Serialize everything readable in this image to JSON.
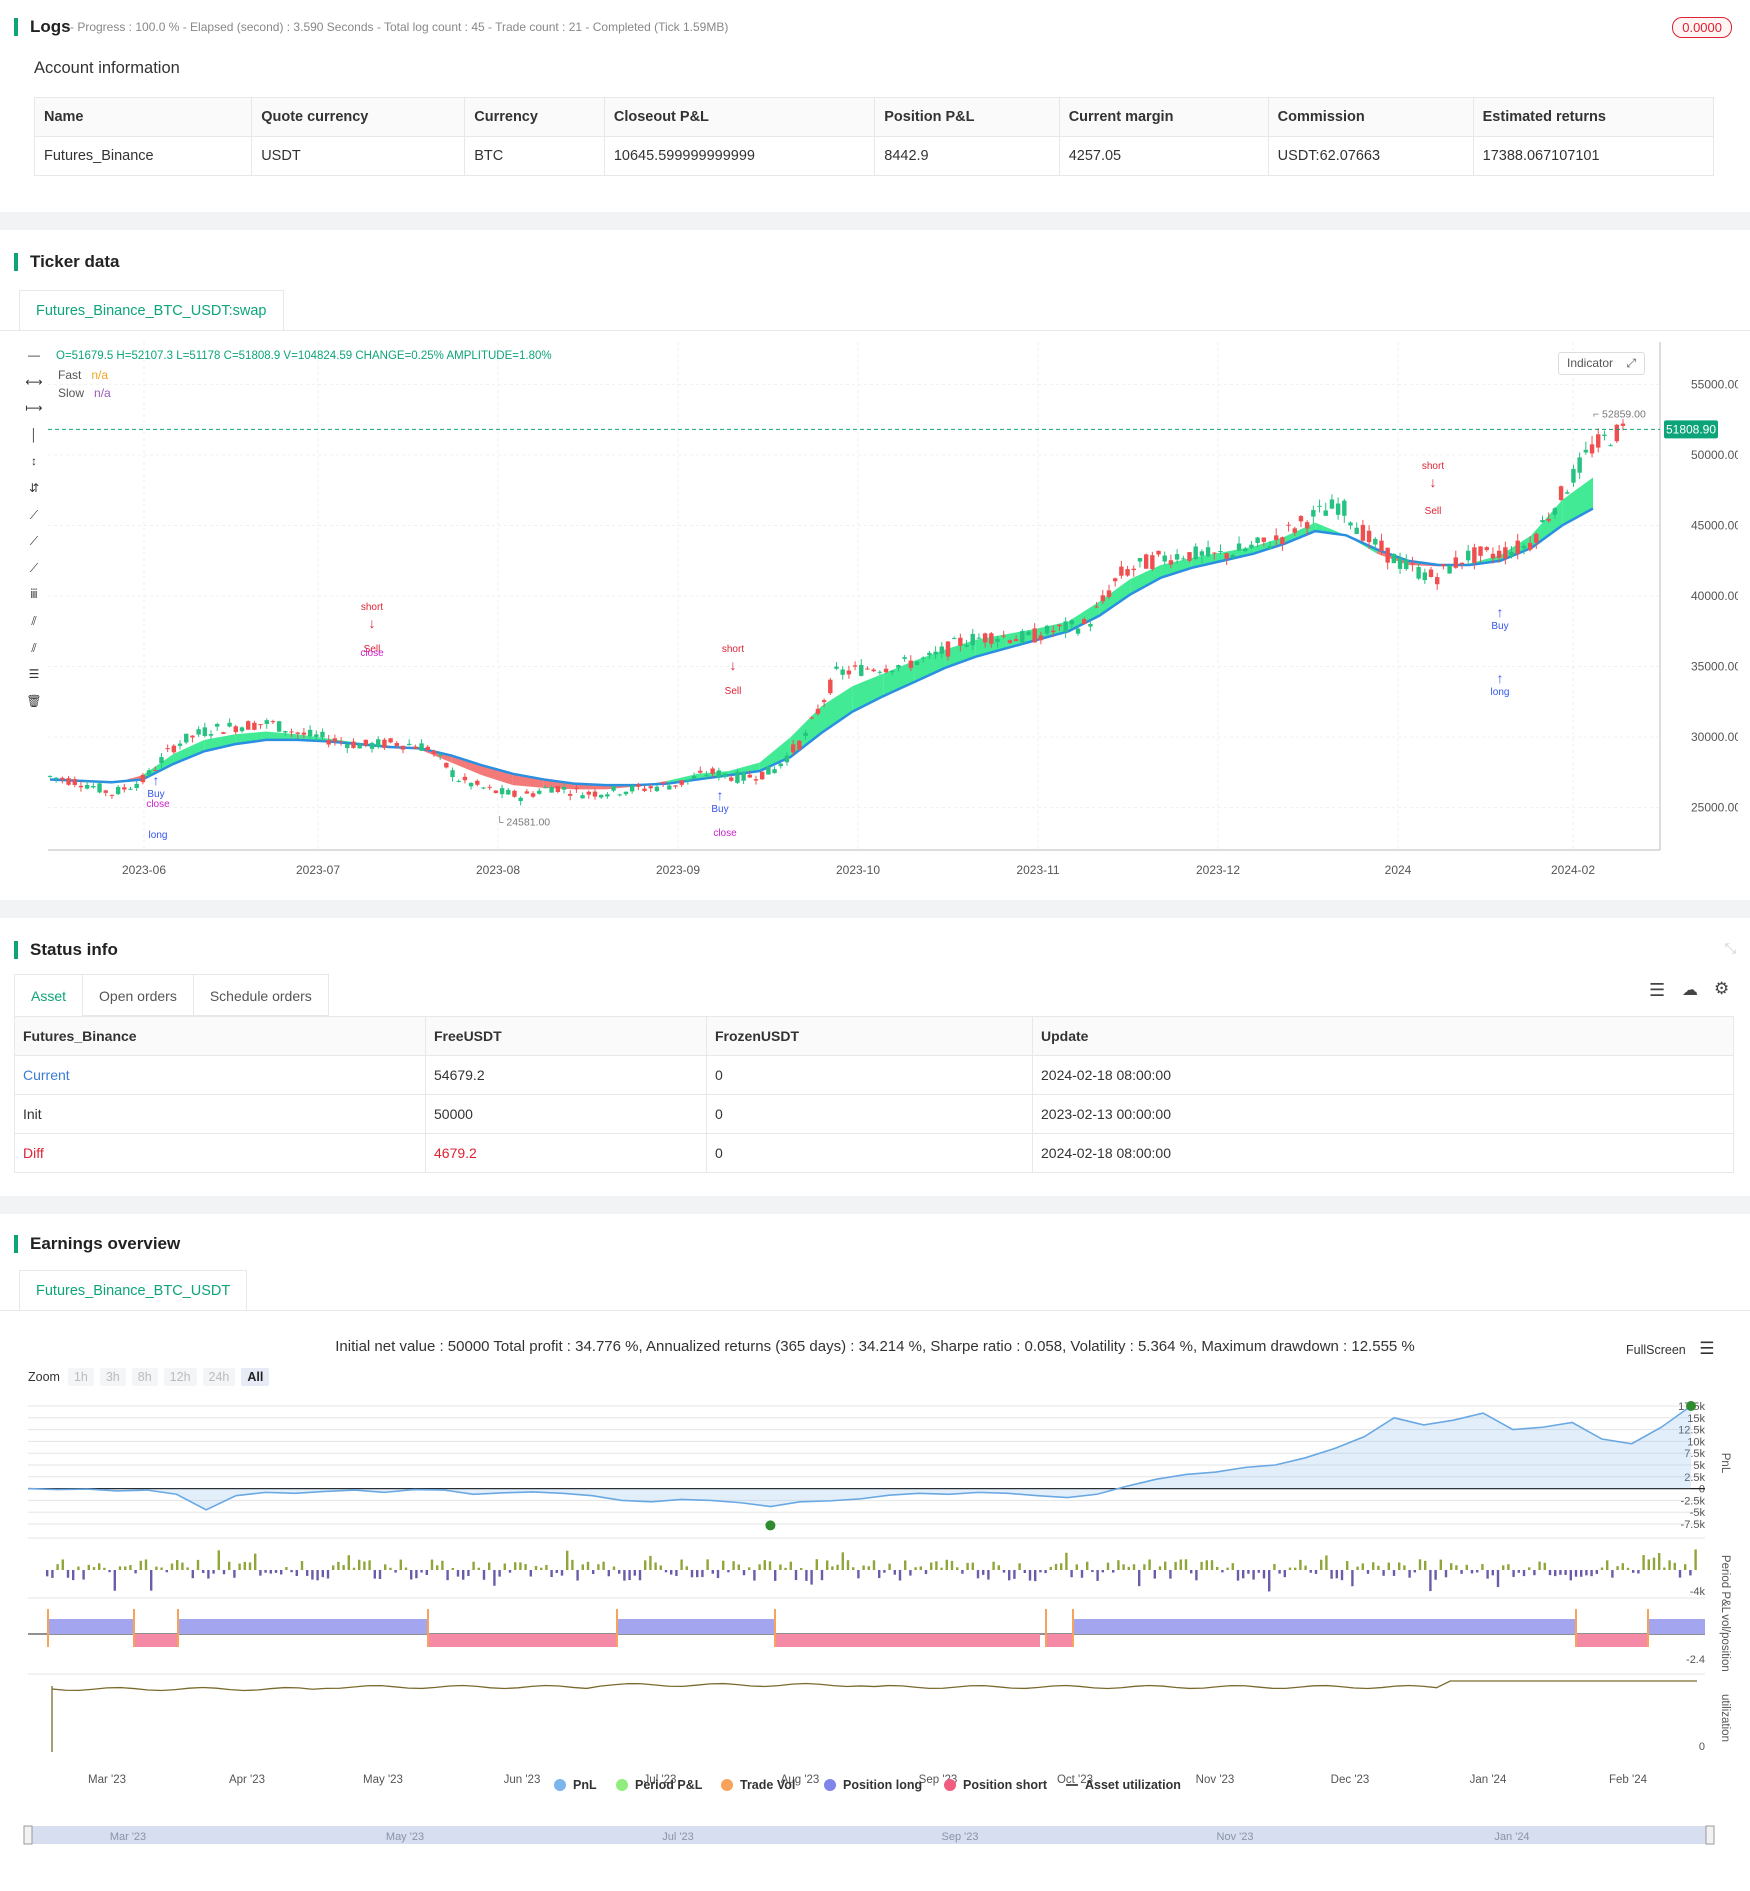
{
  "logs": {
    "title": "Logs",
    "summary": "- Progress : 100.0 % - Elapsed (second) : 3.590  Seconds - Total log count : 45 - Trade count : 21 - Completed (Tick 1.59MB)",
    "badge": "0.0000"
  },
  "account": {
    "title": "Account information",
    "columns": [
      "Name",
      "Quote currency",
      "Currency",
      "Closeout P&L",
      "Position P&L",
      "Current margin",
      "Commission",
      "Estimated returns"
    ],
    "row": [
      "Futures_Binance",
      "USDT",
      "BTC",
      "10645.599999999999",
      "8442.9",
      "4257.05",
      "USDT:62.07663",
      "17388.067107101"
    ]
  },
  "ticker": {
    "title": "Ticker data",
    "tab": "Futures_Binance_BTC_USDT:swap",
    "ohlc": "O=51679.5 H=52107.3 L=51178 C=51808.9 V=104824.59 CHANGE=0.25% AMPLITUDE=1.80%",
    "legend": [
      {
        "name": "Fast",
        "value": "n/a",
        "color": "#f5a623"
      },
      {
        "name": "Slow",
        "value": "n/a",
        "color": "#9b59b6"
      }
    ],
    "indicator_btn": "Indicator",
    "last_price": "51808.90",
    "high_label": "52859.00",
    "low_label": "24581.00",
    "y_ticks": [
      "55000.00",
      "50000.00",
      "45000.00",
      "40000.00",
      "35000.00",
      "30000.00",
      "25000.00"
    ],
    "x_ticks": [
      "2023-06",
      "2023-07",
      "2023-08",
      "2023-09",
      "2023-10",
      "2023-11",
      "2023-12",
      "2024",
      "2024-02"
    ],
    "markers": [
      {
        "text": "Buy",
        "color": "#3355ee"
      },
      {
        "text": "long",
        "color": "#3355ee"
      },
      {
        "text": "close",
        "color": "#cc22cc"
      },
      {
        "text": "short",
        "color": "#dd2233"
      },
      {
        "text": "Sell",
        "color": "#dd2233"
      },
      {
        "text": "close",
        "color": "#cc22cc"
      },
      {
        "text": "short",
        "color": "#dd2233"
      },
      {
        "text": "Sell",
        "color": "#dd2233"
      },
      {
        "text": "Buy",
        "color": "#3355ee"
      },
      {
        "text": "close",
        "color": "#cc22cc"
      },
      {
        "text": "short",
        "color": "#dd2233"
      },
      {
        "text": "Sell",
        "color": "#dd2233"
      },
      {
        "text": "long",
        "color": "#3355ee"
      },
      {
        "text": "Buy",
        "color": "#3355ee"
      }
    ],
    "chart_data": {
      "type": "candlestick",
      "x_labels": [
        "2023-06",
        "2023-07",
        "2023-08",
        "2023-09",
        "2023-10",
        "2023-11",
        "2023-12",
        "2024",
        "2024-02"
      ],
      "ylim": [
        22000,
        58000
      ],
      "close_path": [
        27200,
        26800,
        26000,
        27000,
        29500,
        30500,
        30800,
        31000,
        30200,
        29800,
        29400,
        29600,
        29300,
        27000,
        26200,
        25800,
        26500,
        26000,
        26200,
        26400,
        26700,
        27500,
        27100,
        27600,
        30000,
        34500,
        34900,
        35100,
        35600,
        36800,
        37200,
        37000,
        37600,
        38000,
        41500,
        42500,
        43000,
        42800,
        43300,
        44000,
        45500,
        46500,
        43800,
        42200,
        41300,
        42800,
        43000,
        43600,
        47000,
        50500,
        51800
      ],
      "fast_ma": [
        27000,
        26900,
        26700,
        27300,
        28800,
        29800,
        30200,
        30400,
        30200,
        29900,
        29600,
        29400,
        29100,
        28200,
        27300,
        26600,
        26400,
        26300,
        26300,
        26500,
        26900,
        27400,
        27600,
        28200,
        30000,
        32200,
        33600,
        34500,
        35400,
        36200,
        36900,
        37300,
        37700,
        38200,
        39600,
        41200,
        42200,
        42700,
        43100,
        43500,
        44200,
        45200,
        44300,
        43000,
        42200,
        42100,
        42300,
        42900,
        44300,
        46800,
        48400
      ],
      "slow_ma": [
        27000,
        26900,
        26800,
        27000,
        28100,
        29000,
        29500,
        29800,
        29800,
        29700,
        29500,
        29300,
        29200,
        28700,
        28000,
        27400,
        27000,
        26700,
        26600,
        26600,
        26700,
        27000,
        27300,
        27600,
        28600,
        30300,
        31800,
        32900,
        33900,
        34900,
        35700,
        36300,
        36900,
        37500,
        38600,
        40100,
        41300,
        42000,
        42500,
        43000,
        43700,
        44600,
        44300,
        43300,
        42500,
        42200,
        42200,
        42500,
        43400,
        45000,
        46200
      ]
    }
  },
  "status": {
    "title": "Status info",
    "tabs": [
      "Asset",
      "Open orders",
      "Schedule orders"
    ],
    "columns": [
      "Futures_Binance",
      "FreeUSDT",
      "FrozenUSDT",
      "Update"
    ],
    "rows": [
      {
        "label": "Current",
        "free": "54679.2",
        "frozen": "0",
        "update": "2024-02-18 08:00:00",
        "color": "#3a7bd5"
      },
      {
        "label": "Init",
        "free": "50000",
        "frozen": "0",
        "update": "2023-02-13 00:00:00",
        "color": "#333"
      },
      {
        "label": "Diff",
        "free": "4679.2",
        "frozen": "0",
        "update": "2024-02-18 08:00:00",
        "color": "#dd2233"
      }
    ]
  },
  "earnings": {
    "title": "Earnings overview",
    "tab": "Futures_Binance_BTC_USDT",
    "summary": "Initial net value : 50000 Total profit : 34.776 %, Annualized returns (365 days) : 34.214 %, Sharpe ratio : 0.058, Volatility : 5.364 %, Maximum drawdown : 12.555 %",
    "fullscreen": "FullScreen",
    "zoom_label": "Zoom",
    "zoom_options": [
      "1h",
      "3h",
      "8h",
      "12h",
      "24h",
      "All"
    ],
    "pnl_ticks": [
      "17.5k",
      "15k",
      "12.5k",
      "10k",
      "7.5k",
      "5k",
      "2.5k",
      "0",
      "-2.5k",
      "-5k",
      "-7.5k"
    ],
    "period_tick": "-4k",
    "pos_tick": "-2.4",
    "util_tick": "0",
    "axis_names": [
      "PnL",
      "Period P&L",
      "vol/position",
      "utilization"
    ],
    "x_ticks": [
      "Mar '23",
      "Apr '23",
      "May '23",
      "Jun '23",
      "Jul '23",
      "Aug '23",
      "Sep '23",
      "Oct '23",
      "Nov '23",
      "Dec '23",
      "Jan '24",
      "Feb '24"
    ],
    "nav_ticks": [
      "Mar '23",
      "May '23",
      "Jul '23",
      "Sep '23",
      "Nov '23",
      "Jan '24"
    ],
    "legend": [
      {
        "name": "PnL",
        "color": "#7cb5ec"
      },
      {
        "name": "Period P&L",
        "color": "#90ed7d"
      },
      {
        "name": "Trade Vol",
        "color": "#f7a35c"
      },
      {
        "name": "Position long",
        "color": "#8085e9"
      },
      {
        "name": "Position short",
        "color": "#f15c80"
      },
      {
        "name": "Asset utilization",
        "color": "#555"
      }
    ],
    "chart_data": {
      "type": "line",
      "pnl": [
        0,
        -200,
        -100,
        -500,
        -300,
        -1200,
        -4500,
        -1500,
        -800,
        -1000,
        -600,
        -300,
        -800,
        -200,
        -300,
        -1200,
        -900,
        -700,
        -1000,
        -1500,
        -2500,
        -2800,
        -2300,
        -2500,
        -3000,
        -3800,
        -2800,
        -2600,
        -2200,
        -1400,
        -1000,
        -1200,
        -800,
        -1000,
        -1500,
        -1900,
        -1200,
        500,
        2000,
        3000,
        3500,
        4500,
        5000,
        6500,
        8500,
        11000,
        15000,
        13500,
        14500,
        16000,
        12500,
        13000,
        14000,
        10500,
        9500,
        13000,
        17500
      ],
      "period_pnl_note": "bar series",
      "position_segments": [
        "long",
        "short",
        "long",
        "short",
        "long",
        "short",
        "short",
        "long",
        "short",
        "long"
      ],
      "ylim": [
        -7500,
        17500
      ]
    }
  }
}
